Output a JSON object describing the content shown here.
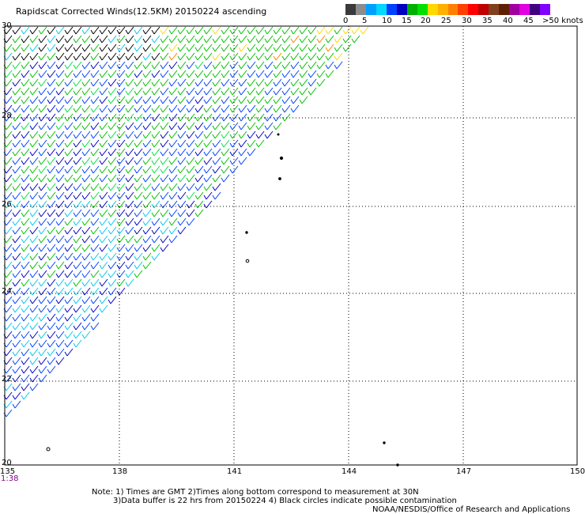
{
  "title": "Rapidscat Corrected Winds(12.5KM) 20150224 ascending",
  "colorbar": {
    "labels": [
      "0",
      "5",
      "10",
      "15",
      "20",
      "25",
      "30",
      "35",
      "40",
      "45",
      ">50 knots"
    ],
    "colors": [
      "#3a3a3a",
      "#8c8c8c",
      "#00a0ff",
      "#00d8ff",
      "#0040ff",
      "#0000c0",
      "#00b000",
      "#00e000",
      "#ffd800",
      "#ffb000",
      "#ff8000",
      "#ff4000",
      "#ff0000",
      "#c00000",
      "#804020",
      "#602000",
      "#a000a0",
      "#e000e0",
      "#400080",
      "#8000ff"
    ]
  },
  "map": {
    "lon_labels": [
      "135",
      "138",
      "141",
      "144",
      "147",
      "150"
    ],
    "lat_labels": [
      "30",
      "28",
      "26",
      "24",
      "22",
      "20"
    ],
    "time_label": "1:38"
  },
  "notes": {
    "line1": "Note: 1) Times are GMT 2)Times along bottom correspond to measurement at 30N",
    "line2": "3)Data buffer is 22 hrs from 20150224 4) Black circles indicate possible contamination",
    "line3": "NOAA/NESDIS/Office of Research and Applications"
  },
  "wind_colors": {
    "light": "#000000",
    "cyan": "#00c8f0",
    "blue": "#0040ff",
    "navy": "#0000c0",
    "green": "#00c000",
    "lightgreen": "#00e040",
    "yellow": "#ffd800",
    "orange": "#ff8000"
  }
}
